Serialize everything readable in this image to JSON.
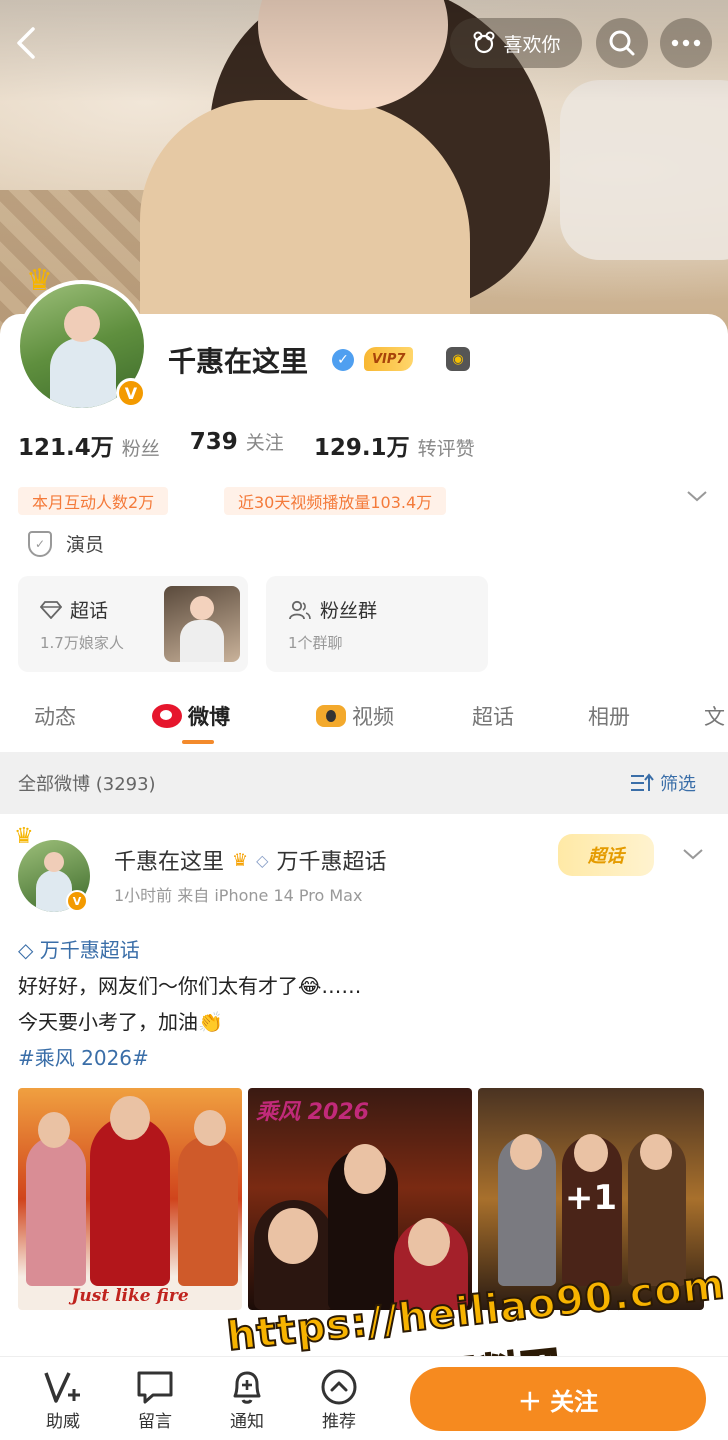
{
  "nav": {
    "back_icon": "chevron-left-icon",
    "like_label": "喜欢你",
    "like_icon": "doll-icon",
    "search_icon": "search-icon",
    "more_icon": "more-icon"
  },
  "profile": {
    "name": "千惠在这里",
    "vip_label": "VIP7",
    "badge_letter": "V",
    "stats": [
      {
        "value": "121.4万",
        "label": "粉丝"
      },
      {
        "value": "739",
        "label": "关注"
      },
      {
        "value": "129.1万",
        "label": "转评赞"
      }
    ],
    "tags": [
      "本月互动人数2万",
      "近30天视频播放量103.4万"
    ],
    "occupation": "演员",
    "boxes": [
      {
        "title": "超话",
        "sub": "1.7万娘家人"
      },
      {
        "title": "粉丝群",
        "sub": "1个群聊"
      }
    ]
  },
  "tabs": {
    "items": [
      "动态",
      "微博",
      "视频",
      "超话",
      "相册",
      "文"
    ],
    "active": "微博"
  },
  "filter": {
    "all_label": "全部微博 (3293)",
    "filter_label": "筛选"
  },
  "post": {
    "author": "千惠在这里",
    "topic_link": "万千惠超话",
    "meta": "1小时前  来自 iPhone 14 Pro Max",
    "chaohua_badge": "超话",
    "topic_line": "万千惠超话",
    "line1": "好好好，网友们～你们太有才了😂……",
    "line2": "今天要小考了，加油👏",
    "hashtag": "#乘风 2026#",
    "image1_caption": "Just like fire",
    "image2_badge": "乘风 2026",
    "image3_more": "+1"
  },
  "bottom": {
    "items": [
      {
        "label": "助威",
        "icon": "v-plus-icon"
      },
      {
        "label": "留言",
        "icon": "comment-icon"
      },
      {
        "label": "通知",
        "icon": "bell-plus-icon"
      },
      {
        "label": "推荐",
        "icon": "arrow-up-circle-icon"
      }
    ],
    "follow_label": "＋ 关注"
  },
  "watermark": {
    "url": "https://heiliao90.com",
    "brand": "黑料网"
  },
  "colors": {
    "accent": "#f68a1f",
    "link": "#3a6ea8",
    "tag_text": "#f47a3a",
    "tag_bg": "#fff1e8",
    "weibo_red": "#e6162d"
  }
}
